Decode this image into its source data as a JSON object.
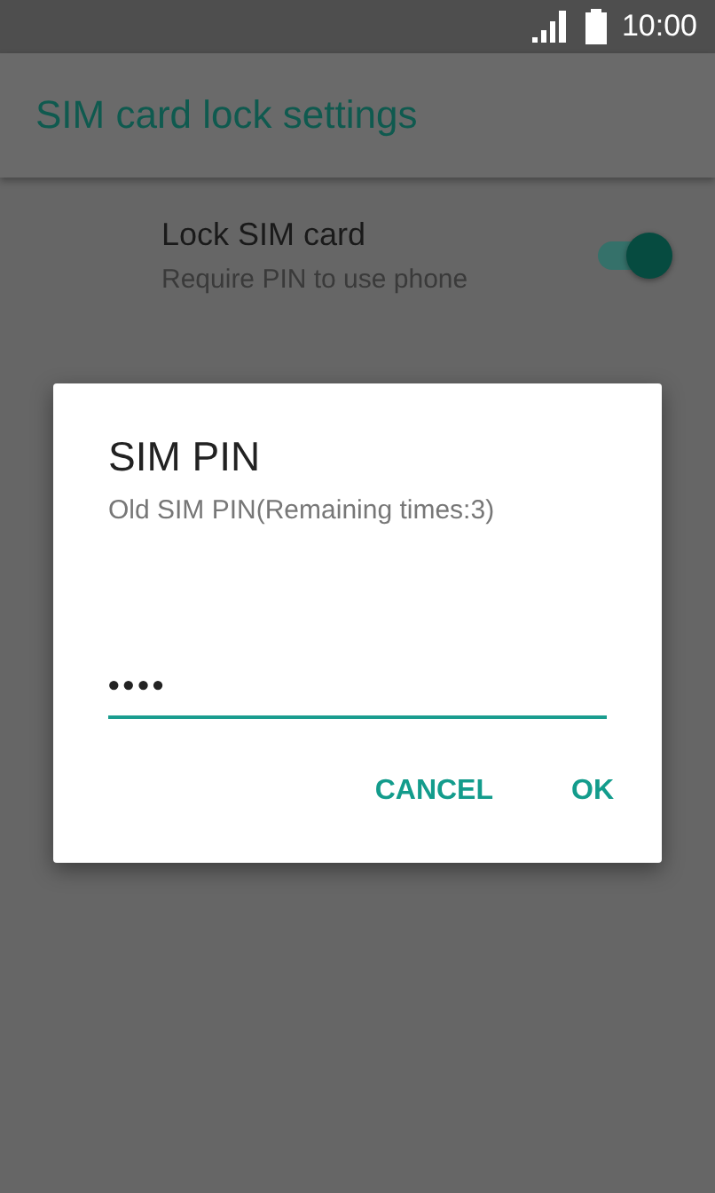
{
  "status_bar": {
    "time": "10:00"
  },
  "app_bar": {
    "title": "SIM card lock settings"
  },
  "settings": [
    {
      "title": "Lock SIM card",
      "summary": "Require PIN to use phone",
      "on": true
    }
  ],
  "dialog": {
    "title": "SIM PIN",
    "message": "Old SIM PIN(Remaining times:3)",
    "pin_value": "••••",
    "buttons": [
      {
        "label": "CANCEL"
      },
      {
        "label": "OK"
      }
    ]
  }
}
